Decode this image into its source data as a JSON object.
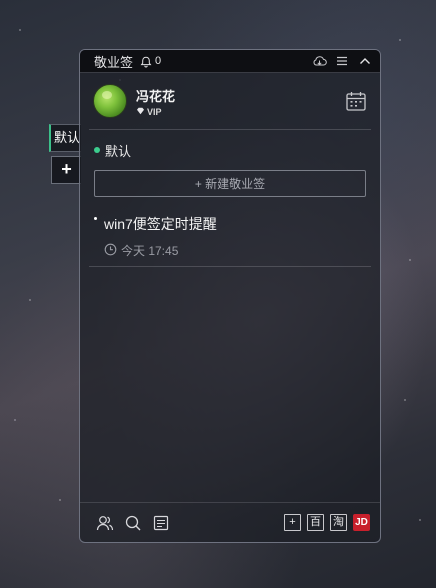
{
  "side": {
    "default_tab_label": "默认",
    "add_tab_label": "+"
  },
  "titlebar": {
    "app_title": "敬业签",
    "notification_count": "0",
    "icons": [
      "bell-icon",
      "cloud-sync-icon",
      "menu-icon",
      "collapse-icon"
    ]
  },
  "user": {
    "name": "冯花花",
    "badge": "VIP"
  },
  "category": {
    "label": "默认",
    "accent_color": "#3ccd8e"
  },
  "new_note_button": {
    "label": "+ 新建敬业签"
  },
  "notes": [
    {
      "title": "win7便签定时提醒",
      "time": "今天 17:45"
    }
  ],
  "bottombar": {
    "left_icons": [
      "contacts-icon",
      "search-icon",
      "notes-list-icon"
    ],
    "add_label": "+",
    "baidu_label": "百",
    "taobao_label": "淘",
    "jd_label": "JD",
    "jd_color": "#c8202c"
  }
}
